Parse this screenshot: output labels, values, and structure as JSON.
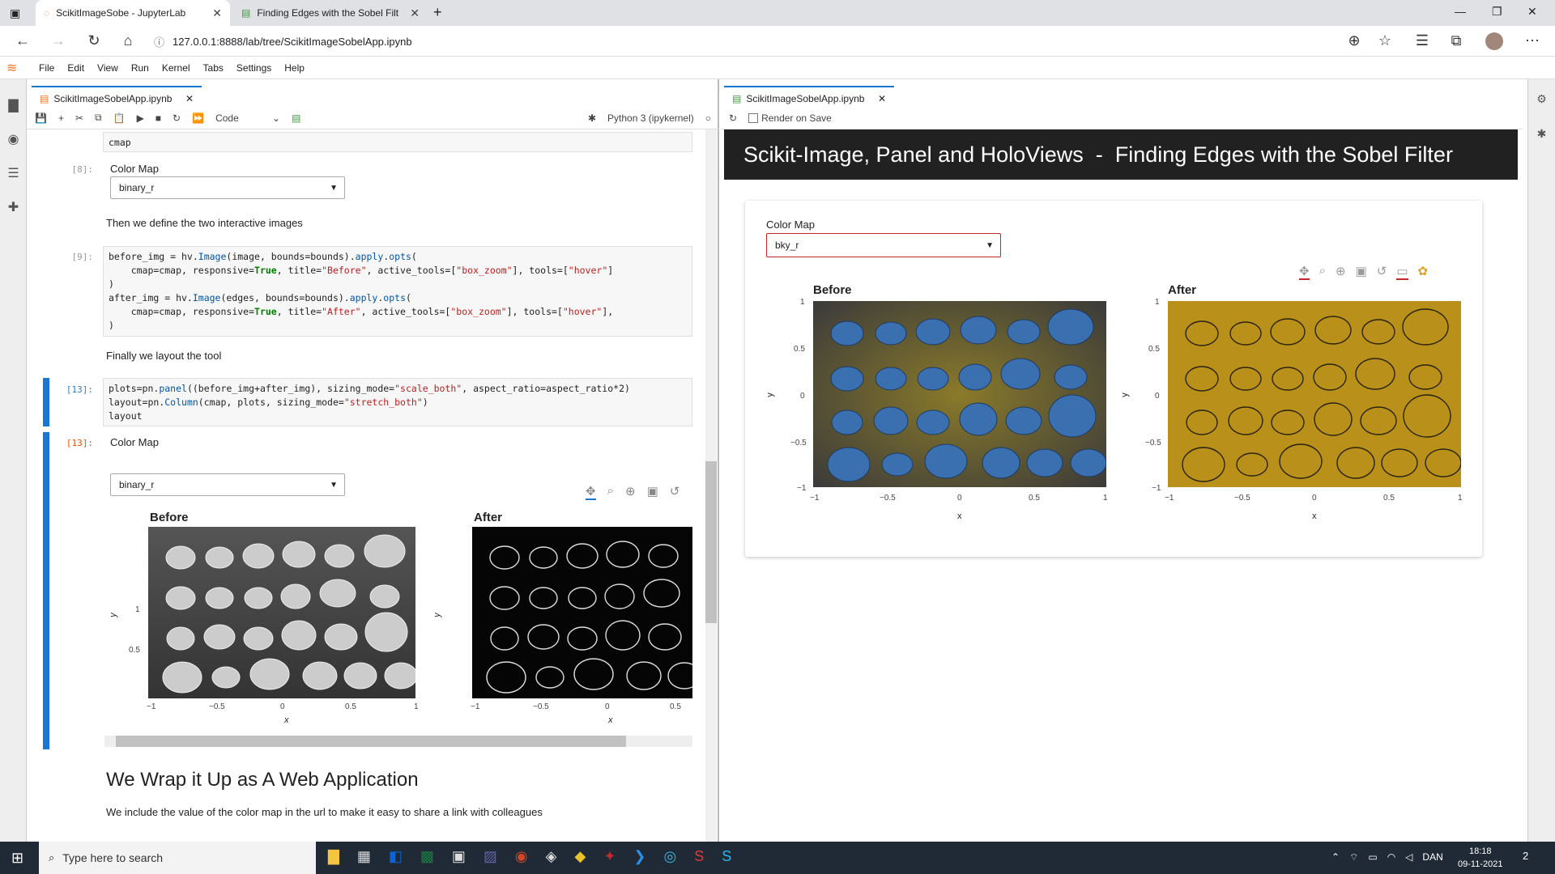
{
  "browser": {
    "tabs": [
      {
        "label": "ScikitImageSobe - JupyterLab"
      },
      {
        "label": "Finding Edges with the Sobel Filt"
      }
    ],
    "url": "127.0.0.1:8888/lab/tree/ScikitImageSobelApp.ipynb"
  },
  "menu": [
    "File",
    "Edit",
    "View",
    "Run",
    "Kernel",
    "Tabs",
    "Settings",
    "Help"
  ],
  "notebook": {
    "tab_label": "ScikitImageSobelApp.ipynb",
    "cell_type": "Code",
    "kernel": "Python 3 (ipykernel)",
    "top_code": "cmap",
    "cell8_prompt": "[8]:",
    "cmap_label": "Color Map",
    "cmap_value": "binary_r",
    "md1": "Then we define the two interactive images",
    "cell9_prompt": "[9]:",
    "md2": "Finally we layout the tool",
    "cell13_prompt": "[13]:",
    "out13_prompt": "[13]:",
    "before_title": "Before",
    "after_title": "After",
    "xlabel": "x",
    "ylabel": "y",
    "heading": "We Wrap it Up as A Web Application",
    "md3": "We include the value of the color map in the url to make it easy to share a link with colleagues"
  },
  "ticks": {
    "y": [
      "1",
      "0.5",
      "0",
      "−0.5",
      "−1"
    ],
    "x": [
      "−1",
      "−0.5",
      "0",
      "0.5",
      "1"
    ]
  },
  "preview": {
    "tab_label": "ScikitImageSobelApp.ipynb",
    "render_on_save": "Render on Save",
    "title": "Scikit-Image, Panel and HoloViews  -  Finding Edges with the Sobel Filter",
    "cmap_label": "Color Map",
    "cmap_value": "bky_r",
    "before_title": "Before",
    "after_title": "After"
  },
  "taskbar": {
    "search_placeholder": "Type here to search",
    "lang": "DAN",
    "time": "18:18",
    "date": "09-11-2021",
    "notif": "2"
  },
  "colors": {
    "accent": "#1976d2",
    "header_bg": "#212121",
    "gold": "#b8901a",
    "coin_blue": "#3a6fb0"
  }
}
